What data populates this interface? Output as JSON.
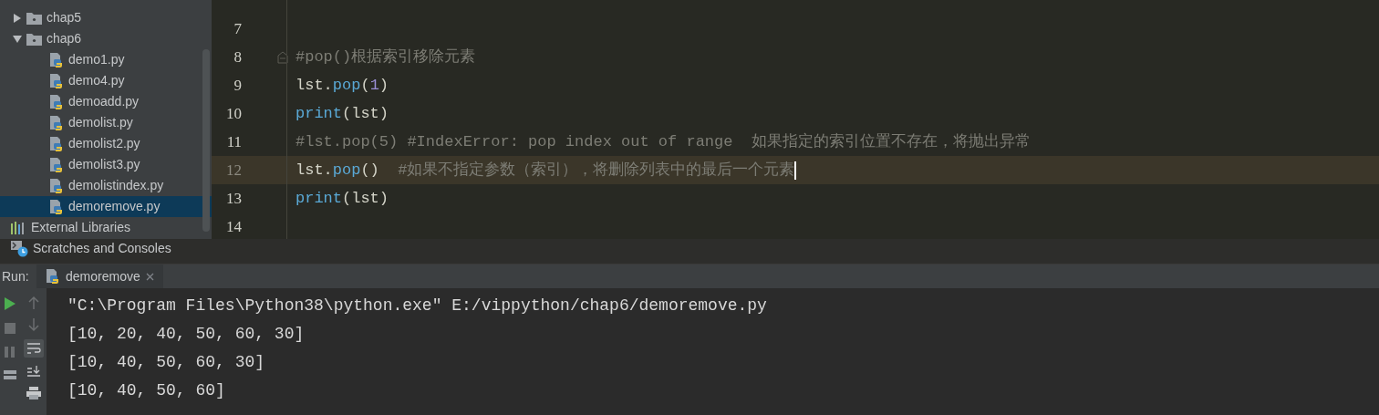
{
  "project_tree": [
    {
      "label": "chap5",
      "kind": "folder",
      "expanded": false,
      "selected": false
    },
    {
      "label": "chap6",
      "kind": "folder",
      "expanded": true,
      "selected": false,
      "children": [
        {
          "label": "demo1.py",
          "kind": "python",
          "selected": false
        },
        {
          "label": "demo4.py",
          "kind": "python",
          "selected": false
        },
        {
          "label": "demoadd.py",
          "kind": "python",
          "selected": false
        },
        {
          "label": "demolist.py",
          "kind": "python",
          "selected": false
        },
        {
          "label": "demolist2.py",
          "kind": "python",
          "selected": false
        },
        {
          "label": "demolist3.py",
          "kind": "python",
          "selected": false
        },
        {
          "label": "demolistindex.py",
          "kind": "python",
          "selected": false
        },
        {
          "label": "demoremove.py",
          "kind": "python",
          "selected": true
        }
      ]
    },
    {
      "label": "External Libraries",
      "kind": "libraries",
      "selected": false
    },
    {
      "label": "Scratches and Consoles",
      "kind": "scratches",
      "selected": false
    }
  ],
  "editor": {
    "lines": [
      {
        "number": "7",
        "current": false,
        "fold": false
      },
      {
        "number": "8",
        "current": false,
        "fold": true,
        "tokens": [
          {
            "kind": "comment",
            "text": "#pop()根据索引移除元素"
          }
        ]
      },
      {
        "number": "9",
        "current": false,
        "fold": false,
        "tokens": [
          {
            "kind": "plain",
            "text": "lst."
          },
          {
            "kind": "method",
            "text": "pop"
          },
          {
            "kind": "plain",
            "text": "("
          },
          {
            "kind": "number",
            "text": "1"
          },
          {
            "kind": "plain",
            "text": ")"
          }
        ]
      },
      {
        "number": "10",
        "current": false,
        "fold": false,
        "tokens": [
          {
            "kind": "builtin",
            "text": "print"
          },
          {
            "kind": "plain",
            "text": "(lst)"
          }
        ]
      },
      {
        "number": "11",
        "current": false,
        "fold": false,
        "tokens": [
          {
            "kind": "comment",
            "text": "#lst.pop(5) #IndexError: pop index out of range  如果指定的索引位置不存在，将抛出异常"
          }
        ]
      },
      {
        "number": "12",
        "current": true,
        "fold": false,
        "tokens": [
          {
            "kind": "plain",
            "text": "lst."
          },
          {
            "kind": "method",
            "text": "pop"
          },
          {
            "kind": "plain",
            "text": "()  "
          },
          {
            "kind": "comment",
            "text": "#如果不指定参数（索引），将删除列表中的最后一个元素"
          }
        ]
      },
      {
        "number": "13",
        "current": false,
        "fold": false,
        "tokens": [
          {
            "kind": "builtin",
            "text": "print"
          },
          {
            "kind": "plain",
            "text": "(lst)"
          }
        ]
      },
      {
        "number": "14",
        "current": false,
        "fold": false
      }
    ]
  },
  "run_panel": {
    "label": "Run:",
    "tab": "demoremove",
    "output": [
      "\"C:\\Program Files\\Python38\\python.exe\" E:/vippython/chap6/demoremove.py",
      "[10, 20, 40, 50, 60, 30]",
      "[10, 40, 50, 60, 30]",
      "[10, 40, 50, 60]"
    ]
  }
}
